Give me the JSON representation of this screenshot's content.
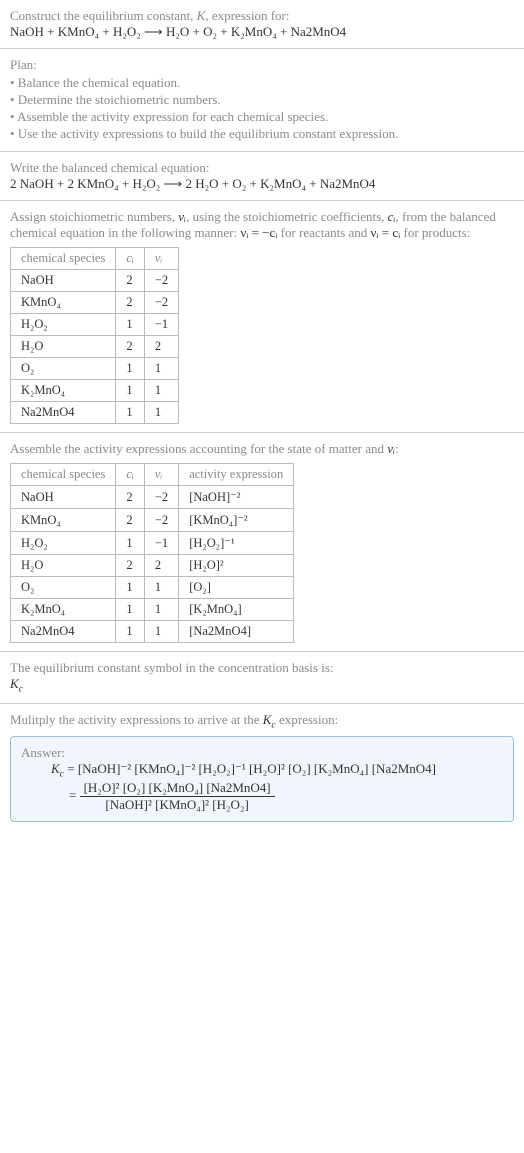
{
  "header": {
    "prompt_part1": "Construct the equilibrium constant, ",
    "K": "K",
    "prompt_part2": ", expression for:",
    "equation": "NaOH + KMnO₄ + H₂O₂  ⟶  H₂O + O₂ + K₂MnO₄ + Na2MnO4"
  },
  "plan": {
    "title": "Plan:",
    "items": [
      "• Balance the chemical equation.",
      "• Determine the stoichiometric numbers.",
      "• Assemble the activity expression for each chemical species.",
      "• Use the activity expressions to build the equilibrium constant expression."
    ]
  },
  "balanced": {
    "title": "Write the balanced chemical equation:",
    "equation": "2 NaOH + 2 KMnO₄ + H₂O₂  ⟶  2 H₂O + O₂ + K₂MnO₄ + Na2MnO4"
  },
  "assign_stoich": {
    "text_a": "Assign stoichiometric numbers, ",
    "nu": "νᵢ",
    "text_b": ", using the stoichiometric coefficients, ",
    "ci": "cᵢ",
    "text_c": ", from the balanced chemical equation in the following manner: ",
    "rel1": "νᵢ = −cᵢ",
    "text_d": " for reactants and ",
    "rel2": "νᵢ = cᵢ",
    "text_e": " for products:"
  },
  "table1": {
    "headers": [
      "chemical species",
      "cᵢ",
      "νᵢ"
    ],
    "rows": [
      [
        "NaOH",
        "2",
        "−2"
      ],
      [
        "KMnO₄",
        "2",
        "−2"
      ],
      [
        "H₂O₂",
        "1",
        "−1"
      ],
      [
        "H₂O",
        "2",
        "2"
      ],
      [
        "O₂",
        "1",
        "1"
      ],
      [
        "K₂MnO₄",
        "1",
        "1"
      ],
      [
        "Na2MnO4",
        "1",
        "1"
      ]
    ]
  },
  "assemble": {
    "text_a": "Assemble the activity expressions accounting for the state of matter and ",
    "nu": "νᵢ",
    "text_b": ":"
  },
  "table2": {
    "headers": [
      "chemical species",
      "cᵢ",
      "νᵢ",
      "activity expression"
    ],
    "rows": [
      [
        "NaOH",
        "2",
        "−2",
        "[NaOH]⁻²"
      ],
      [
        "KMnO₄",
        "2",
        "−2",
        "[KMnO₄]⁻²"
      ],
      [
        "H₂O₂",
        "1",
        "−1",
        "[H₂O₂]⁻¹"
      ],
      [
        "H₂O",
        "2",
        "2",
        "[H₂O]²"
      ],
      [
        "O₂",
        "1",
        "1",
        "[O₂]"
      ],
      [
        "K₂MnO₄",
        "1",
        "1",
        "[K₂MnO₄]"
      ],
      [
        "Na2MnO4",
        "1",
        "1",
        "[Na2MnO4]"
      ]
    ]
  },
  "symbol_line": {
    "text": "The equilibrium constant symbol in the concentration basis is:",
    "Kc": "K_c"
  },
  "multiply_line": {
    "text_a": "Mulitply the activity expressions to arrive at the ",
    "Kc": "K_c",
    "text_b": " expression:"
  },
  "answer": {
    "label": "Answer:",
    "lhs": "K_c",
    "line1": " = [NaOH]⁻² [KMnO₄]⁻² [H₂O₂]⁻¹ [H₂O]² [O₂] [K₂MnO₄] [Na2MnO4]",
    "frac_num": "[H₂O]² [O₂] [K₂MnO₄] [Na2MnO4]",
    "frac_den": "[NaOH]² [KMnO₄]² [H₂O₂]"
  },
  "chart_data": {
    "type": "table",
    "tables": [
      {
        "title": "stoichiometric numbers",
        "headers": [
          "chemical species",
          "c_i",
          "nu_i"
        ],
        "rows": [
          {
            "species": "NaOH",
            "c_i": 2,
            "nu_i": -2
          },
          {
            "species": "KMnO4",
            "c_i": 2,
            "nu_i": -2
          },
          {
            "species": "H2O2",
            "c_i": 1,
            "nu_i": -1
          },
          {
            "species": "H2O",
            "c_i": 2,
            "nu_i": 2
          },
          {
            "species": "O2",
            "c_i": 1,
            "nu_i": 1
          },
          {
            "species": "K2MnO4",
            "c_i": 1,
            "nu_i": 1
          },
          {
            "species": "Na2MnO4",
            "c_i": 1,
            "nu_i": 1
          }
        ]
      },
      {
        "title": "activity expressions",
        "headers": [
          "chemical species",
          "c_i",
          "nu_i",
          "activity expression"
        ],
        "rows": [
          {
            "species": "NaOH",
            "c_i": 2,
            "nu_i": -2,
            "activity": "[NaOH]^-2"
          },
          {
            "species": "KMnO4",
            "c_i": 2,
            "nu_i": -2,
            "activity": "[KMnO4]^-2"
          },
          {
            "species": "H2O2",
            "c_i": 1,
            "nu_i": -1,
            "activity": "[H2O2]^-1"
          },
          {
            "species": "H2O",
            "c_i": 2,
            "nu_i": 2,
            "activity": "[H2O]^2"
          },
          {
            "species": "O2",
            "c_i": 1,
            "nu_i": 1,
            "activity": "[O2]"
          },
          {
            "species": "K2MnO4",
            "c_i": 1,
            "nu_i": 1,
            "activity": "[K2MnO4]"
          },
          {
            "species": "Na2MnO4",
            "c_i": 1,
            "nu_i": 1,
            "activity": "[Na2MnO4]"
          }
        ]
      }
    ]
  }
}
